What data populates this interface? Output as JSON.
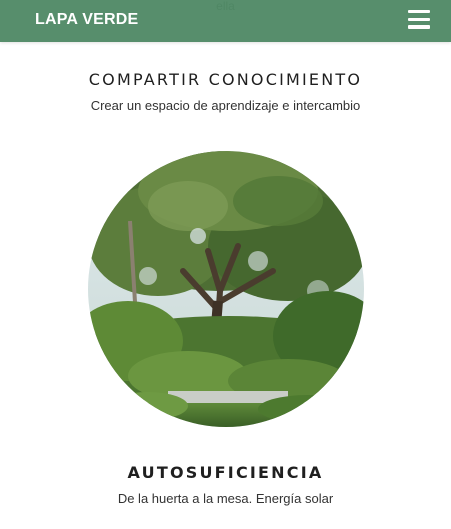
{
  "ghost_text": "ella",
  "navbar": {
    "brand": "LAPA VERDE",
    "menu_icon": "hamburger-menu-icon",
    "color": "#4a8561"
  },
  "sections": [
    {
      "title": "COMPARTIR CONOCIMIENTO",
      "subtitle": "Crear un espacio de aprendizaje e intercambio"
    },
    {
      "image": "tree-photo",
      "title": "AUTOSUFICIENCIA",
      "subtitle": "De la huerta a la mesa. Energía solar"
    }
  ]
}
